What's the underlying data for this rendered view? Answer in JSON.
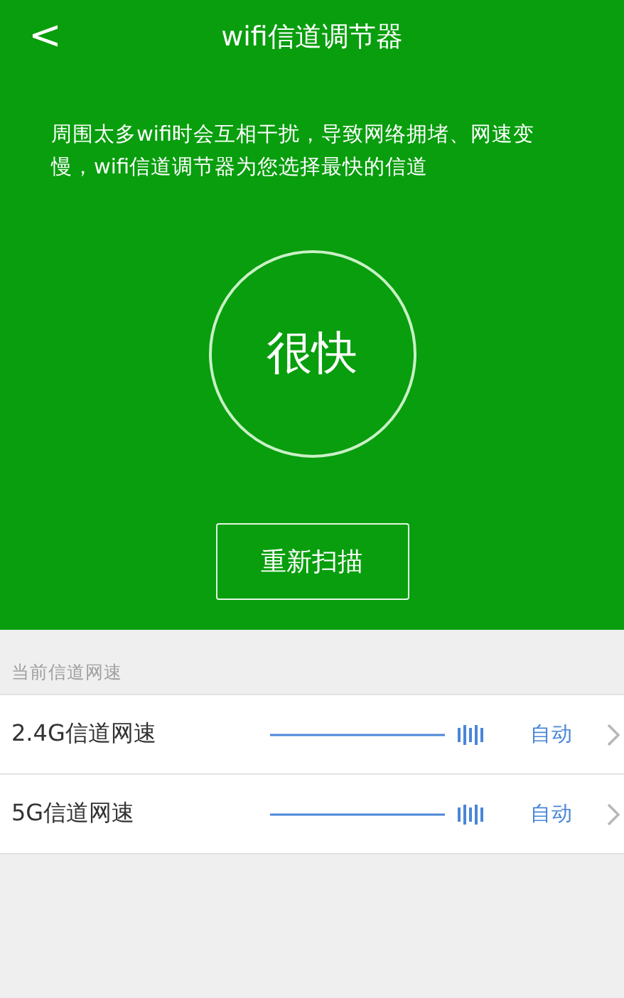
{
  "header": {
    "title": "wifi信道调节器",
    "back": "<"
  },
  "description": "周围太多wifi时会互相干扰，导致网络拥堵、网速变慢，wifi信道调节器为您选择最快的信道",
  "status": "很快",
  "scan_button": "重新扫描",
  "section_label": "当前信道网速",
  "channels": [
    {
      "name": "2.4G信道网速",
      "mode": "自动"
    },
    {
      "name": "5G信道网速",
      "mode": "自动"
    }
  ]
}
